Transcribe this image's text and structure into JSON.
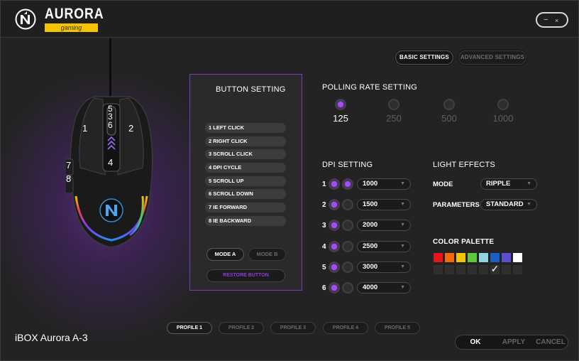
{
  "app": {
    "brand": "AURORA",
    "brand_sub": "gaming",
    "minimize": "−",
    "close": "×"
  },
  "settings_tabs": {
    "basic": "BASIC SETTINGS",
    "advanced": "ADVANCED SETTINGS"
  },
  "mouse_labels": [
    "5",
    "3",
    "6",
    "1",
    "2",
    "7",
    "8",
    "4"
  ],
  "button_setting": {
    "title": "BUTTON SETTING",
    "items": [
      "1 LEFT CLICK",
      "2 RIGHT CLICK",
      "3 SCROLL CLICK",
      "4 DPI CYCLE",
      "5 SCROLL UP",
      "6 SCROLL DOWN",
      "7 IE FORWARD",
      "8 IE BACKWARD"
    ],
    "mode_a": "MODE A",
    "mode_b": "MODE B",
    "restore": "RESTORE BUTTON"
  },
  "polling": {
    "title": "POLLING RATE SETTING",
    "options": [
      "125",
      "250",
      "500",
      "1000"
    ],
    "selected": "125"
  },
  "dpi": {
    "title": "DPI SETTING",
    "rows": [
      {
        "num": "1",
        "value": "1000",
        "active": true
      },
      {
        "num": "2",
        "value": "1500",
        "active": false
      },
      {
        "num": "3",
        "value": "2000",
        "active": false
      },
      {
        "num": "4",
        "value": "2500",
        "active": false
      },
      {
        "num": "5",
        "value": "3000",
        "active": false
      },
      {
        "num": "6",
        "value": "4000",
        "active": false
      }
    ]
  },
  "light": {
    "title": "LIGHT EFFECTS",
    "mode_label": "MODE",
    "mode_value": "RIPPLE",
    "params_label": "PARAMETERS",
    "params_value": "STANDARD",
    "palette_title": "COLOR PALETTE",
    "palette_colors": [
      "#e8141b",
      "#f46a0a",
      "#f4c400",
      "#5cc93a",
      "#8fd6df",
      "#1a5fc4",
      "#5a4fcf",
      "#ffffff"
    ],
    "palette_empty": 8,
    "checkmark": "✓"
  },
  "profiles": {
    "items": [
      "PROFILE 1",
      "PROFILE 2",
      "PROFILE 3",
      "PROFILE 4",
      "PROFILE 5"
    ],
    "active": "PROFILE 1"
  },
  "device_name": "iBOX Aurora A-3",
  "actions": {
    "ok": "OK",
    "apply": "APPLY",
    "cancel": "CANCEL"
  },
  "colors": {
    "accent": "#a34ef5",
    "panel_border": "#7a3db8",
    "brand_yellow": "#f4c400"
  }
}
